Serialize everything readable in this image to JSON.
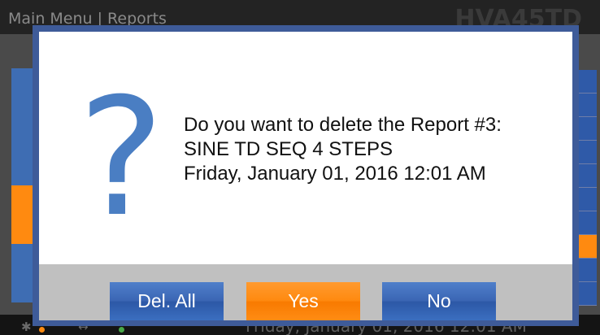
{
  "header": {
    "breadcrumb": "Main Menu  |  Reports",
    "model": "HVA45TD"
  },
  "footer": {
    "datetime": "Friday, January 01, 2016 12:01 AM",
    "bluetooth_icon": "bluetooth-icon",
    "usb_icon": "usb-icon"
  },
  "dialog": {
    "icon": "question-icon",
    "lines": [
      "Do you want to delete the Report #3:",
      "SINE TD SEQ 4 STEPS",
      "Friday, January 01, 2016 12:01 AM"
    ],
    "buttons": {
      "del_all": "Del. All",
      "yes": "Yes",
      "no": "No"
    }
  },
  "colors": {
    "dialog_border": "#3e5b99",
    "question_mark": "#4a7ec3",
    "button_blue": "#3b66b4",
    "button_orange": "#ff8a10",
    "button_bar": "#c0c0c0"
  }
}
